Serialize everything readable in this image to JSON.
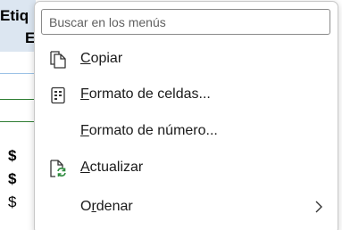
{
  "sheet": {
    "header_line1": "Etiq",
    "header_line2": "E",
    "dollar_sign": "$"
  },
  "menu": {
    "search_placeholder": "Buscar en los menús",
    "items": [
      {
        "mnemonic": "C",
        "rest": "opiar",
        "icon": "copy-icon"
      },
      {
        "mnemonic": "F",
        "rest": "ormato de celdas...",
        "icon": "format-cells-icon"
      },
      {
        "mnemonic": "F",
        "rest": "ormato de número...",
        "icon": ""
      },
      {
        "mnemonic": "A",
        "rest": "ctualizar",
        "icon": "refresh-icon"
      },
      {
        "before": "O",
        "mnemonic": "r",
        "rest": "denar",
        "icon": "",
        "submenu": true
      }
    ]
  },
  "colors": {
    "header_fill": "#dce6f1",
    "refresh_green": "#2e8b3e"
  }
}
